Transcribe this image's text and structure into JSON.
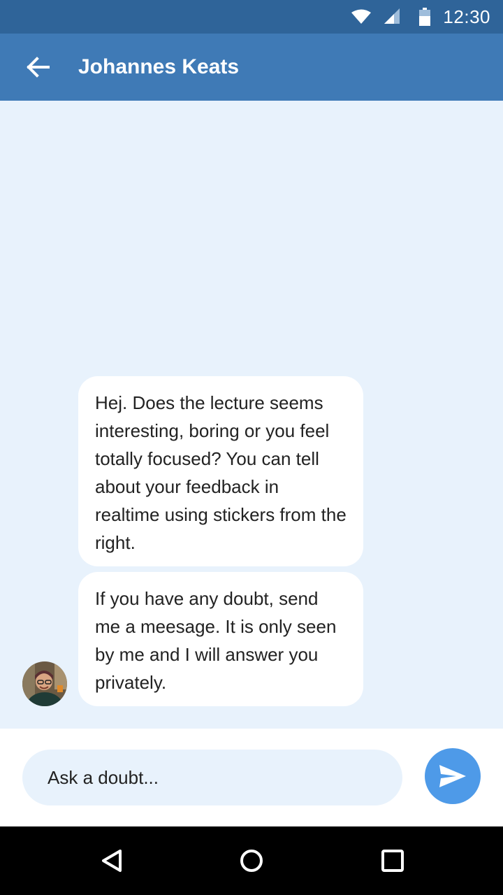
{
  "status_bar": {
    "time": "12:30",
    "icons": [
      "wifi-icon",
      "cellular-signal-icon",
      "battery-icon"
    ]
  },
  "app_bar": {
    "back_icon": "arrow-left-icon",
    "title": "Johannes Keats"
  },
  "chat": {
    "messages": [
      {
        "text": "Hej. Does the lecture seems interesting, boring or you feel totally focused? You can tell about your feedback in realtime using stickers from the right."
      },
      {
        "text": "If you have any doubt, send me a meesage. It is only seen by me and I will answer you privately."
      }
    ],
    "avatar": "contact-avatar"
  },
  "composer": {
    "placeholder": "Ask a doubt...",
    "value": "",
    "send_icon": "send-icon"
  },
  "nav_bar": {
    "icons": [
      "back-triangle-icon",
      "home-circle-icon",
      "recents-square-icon"
    ]
  },
  "colors": {
    "status_bar": "#2f6499",
    "app_bar": "#3f7ab6",
    "chat_background": "#e8f2fc",
    "bubble": "#ffffff",
    "send_button": "#4e9ae8"
  }
}
